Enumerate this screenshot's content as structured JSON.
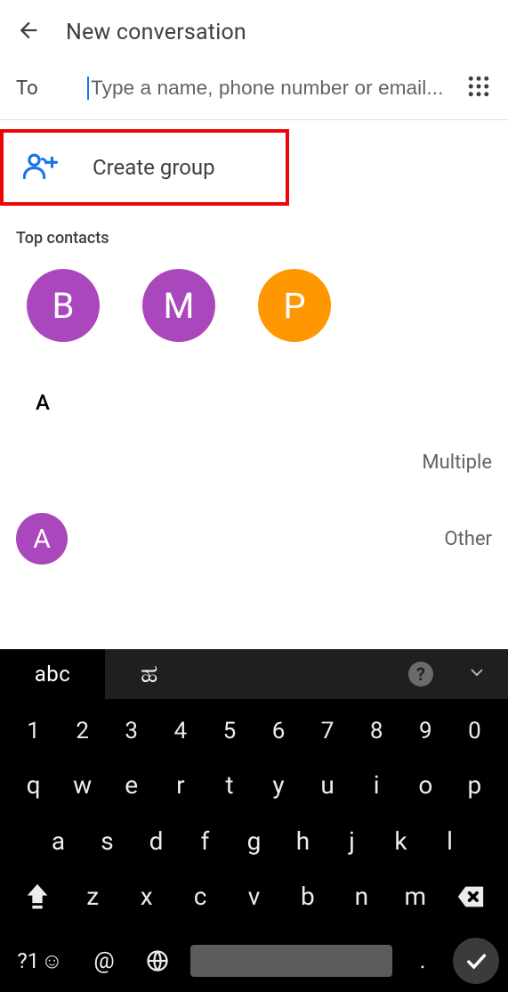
{
  "header": {
    "title": "New conversation"
  },
  "to": {
    "label": "To",
    "placeholder": "Type a name, phone number or email..."
  },
  "create_group": {
    "label": "Create group"
  },
  "top_contacts": {
    "section_label": "Top contacts",
    "items": [
      {
        "initial": "B",
        "color": "purple"
      },
      {
        "initial": "M",
        "color": "purple"
      },
      {
        "initial": "P",
        "color": "orange"
      }
    ]
  },
  "contacts_section": {
    "letter": "A",
    "rows": [
      {
        "initial": "",
        "type_label": "Multiple",
        "avatar_color": "blank"
      },
      {
        "initial": "A",
        "type_label": "Other",
        "avatar_color": "purple"
      }
    ]
  },
  "keyboard": {
    "mode_label": "abc",
    "script_label": "ಹ",
    "row1": [
      "1",
      "2",
      "3",
      "4",
      "5",
      "6",
      "7",
      "8",
      "9",
      "0"
    ],
    "row2": [
      "q",
      "w",
      "e",
      "r",
      "t",
      "y",
      "u",
      "i",
      "o",
      "p"
    ],
    "row3": [
      "a",
      "s",
      "d",
      "f",
      "g",
      "h",
      "j",
      "k",
      "l"
    ],
    "row4": [
      "z",
      "x",
      "c",
      "v",
      "b",
      "n",
      "m"
    ],
    "sym": "?1",
    "at": "@",
    "dot": "."
  }
}
